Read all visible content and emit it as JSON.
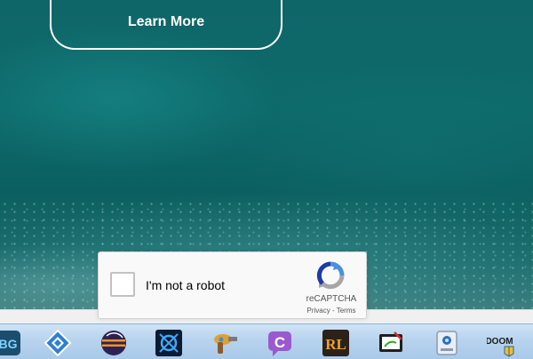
{
  "website": {
    "learn_more_label": "Learn More"
  },
  "recaptcha": {
    "checkbox_label": "I'm not a robot",
    "brand": "reCAPTCHA",
    "privacy_label": "Privacy",
    "separator": " - ",
    "terms_label": "Terms"
  },
  "taskbar": {
    "icons": [
      {
        "name": "bg-app-icon",
        "text": "BG"
      },
      {
        "name": "diamond-app-icon"
      },
      {
        "name": "eclipse-icon"
      },
      {
        "name": "battlenet-icon"
      },
      {
        "name": "ray-gun-icon"
      },
      {
        "name": "c-chat-icon",
        "text": "C"
      },
      {
        "name": "rl-app-icon",
        "text": "RL"
      },
      {
        "name": "drawing-tablet-icon"
      },
      {
        "name": "webcam-icon"
      },
      {
        "name": "doom-icon",
        "text": "DOOM"
      }
    ]
  },
  "colors": {
    "taskbar_bg": "#b7d3ee",
    "recaptcha_blue": "#4a90e2",
    "recaptcha_grey": "#a6a6a6"
  }
}
